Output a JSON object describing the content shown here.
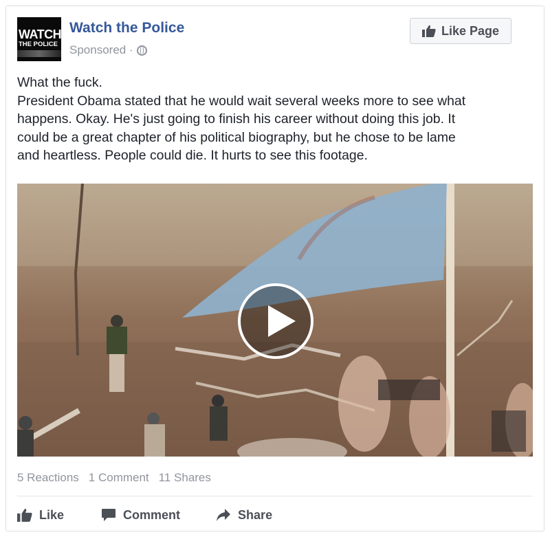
{
  "page": {
    "name": "Watch the Police",
    "avatar_text_line1": "WATCH",
    "avatar_text_line2": "THE POLICE",
    "sponsored": "Sponsored ·"
  },
  "like_page_button": {
    "label": "Like Page"
  },
  "post": {
    "lines": [
      "What the fuck.",
      "President Obama stated that he would wait several weeks more to see what",
      "happens. Okay. He's just going to finish his career without doing this job. It",
      "could be a great chapter of his political biography, but he chose to be lame",
      "and heartless. People could die. It hurts to see this footage."
    ]
  },
  "video": {
    "play_icon": "play-icon"
  },
  "stats": {
    "reactions": "5 Reactions",
    "comments": "1 Comment",
    "shares": "11 Shares"
  },
  "actions": {
    "like": "Like",
    "comment": "Comment",
    "share": "Share"
  },
  "colors": {
    "link": "#365899",
    "secondary_text": "#90949c",
    "action_text": "#4b4f56"
  }
}
